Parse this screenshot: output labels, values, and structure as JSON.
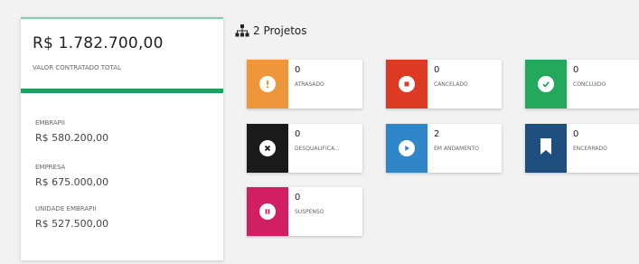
{
  "summary": {
    "total_value": "R$ 1.782.700,00",
    "total_label": "VALOR CONTRATADO TOTAL",
    "breakdown": [
      {
        "label": "EMBRAPII",
        "value": "R$ 580.200,00"
      },
      {
        "label": "EMPRESA",
        "value": "R$ 675.000,00"
      },
      {
        "label": "UNIDADE EMBRAPII",
        "value": "R$ 527.500,00"
      }
    ],
    "accent_color": "#20a060"
  },
  "projects": {
    "header_label": "2 Projetos",
    "header_icon": "sitemap-icon"
  },
  "statuses": [
    {
      "count": "0",
      "label": "ATRASADO",
      "color": "#f0963a",
      "icon": "exclamation-icon"
    },
    {
      "count": "0",
      "label": "CANCELADO",
      "color": "#dc3a22",
      "icon": "stop-icon"
    },
    {
      "count": "0",
      "label": "CONCLUÍDO",
      "color": "#22a95c",
      "icon": "check-icon"
    },
    {
      "count": "0",
      "label": "DESQUALIFICA...",
      "color": "#1a1a1a",
      "icon": "close-icon"
    },
    {
      "count": "2",
      "label": "EM ANDAMENTO",
      "color": "#2e86c8",
      "icon": "play-icon"
    },
    {
      "count": "0",
      "label": "ENCERRADO",
      "color": "#1f4f7e",
      "icon": "bookmark-icon"
    },
    {
      "count": "0",
      "label": "SUSPENSO",
      "color": "#d21e63",
      "icon": "pause-icon"
    }
  ]
}
